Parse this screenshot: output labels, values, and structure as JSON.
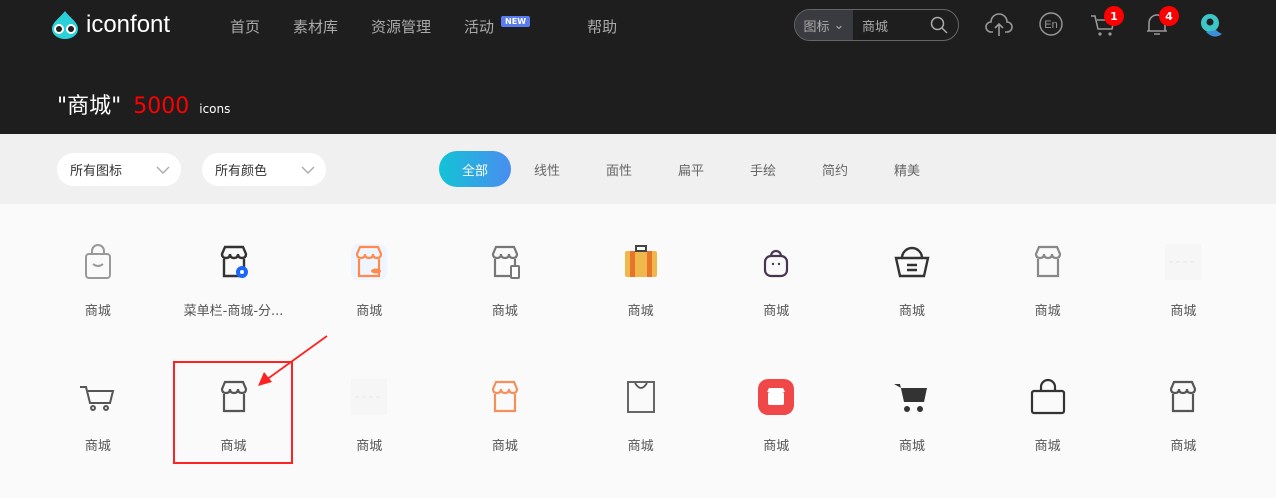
{
  "header": {
    "logo_text": "iconfont",
    "nav": [
      "首页",
      "素材库",
      "资源管理",
      "活动",
      "帮助"
    ],
    "new_badge": "NEW",
    "search": {
      "type": "图标",
      "query": "商城"
    },
    "cart_count": "1",
    "notify_count": "4"
  },
  "result": {
    "query": "\"商城\"",
    "count": "5000",
    "unit": "icons"
  },
  "filters": {
    "select_icons": "所有图标",
    "select_colors": "所有颜色",
    "tabs": [
      "全部",
      "线性",
      "面性",
      "扁平",
      "手绘",
      "简约",
      "精美"
    ],
    "active_tab": 0
  },
  "icons": [
    {
      "label": "商城",
      "icon": "bag-smile",
      "color": "#999999"
    },
    {
      "label": "菜单栏-商城-分...",
      "icon": "store-gear",
      "color": "#333333"
    },
    {
      "label": "商城",
      "icon": "store-coin",
      "color": "#ff8a4c"
    },
    {
      "label": "商城",
      "icon": "store-phone",
      "color": "#777777"
    },
    {
      "label": "商城",
      "icon": "suitcase",
      "color": "#f0b84a"
    },
    {
      "label": "商城",
      "icon": "bag-face",
      "color": "#4a3550"
    },
    {
      "label": "商城",
      "icon": "basket",
      "color": "#333333"
    },
    {
      "label": "商城",
      "icon": "store",
      "color": "#888888"
    },
    {
      "label": "商城",
      "icon": "placeholder",
      "color": "#eeeeee"
    },
    {
      "label": "商城",
      "icon": "cart",
      "color": "#555555"
    },
    {
      "label": "商城",
      "icon": "store",
      "color": "#555555"
    },
    {
      "label": "商城",
      "icon": "placeholder",
      "color": "#eeeeee"
    },
    {
      "label": "商城",
      "icon": "store",
      "color": "#f5905a"
    },
    {
      "label": "商城",
      "icon": "shopping-bag",
      "color": "#555555"
    },
    {
      "label": "商城",
      "icon": "store-badge",
      "color": "#f04848"
    },
    {
      "label": "商城",
      "icon": "cart-filled",
      "color": "#333333"
    },
    {
      "label": "商城",
      "icon": "bag",
      "color": "#333333"
    },
    {
      "label": "商城",
      "icon": "store",
      "color": "#555555"
    }
  ]
}
